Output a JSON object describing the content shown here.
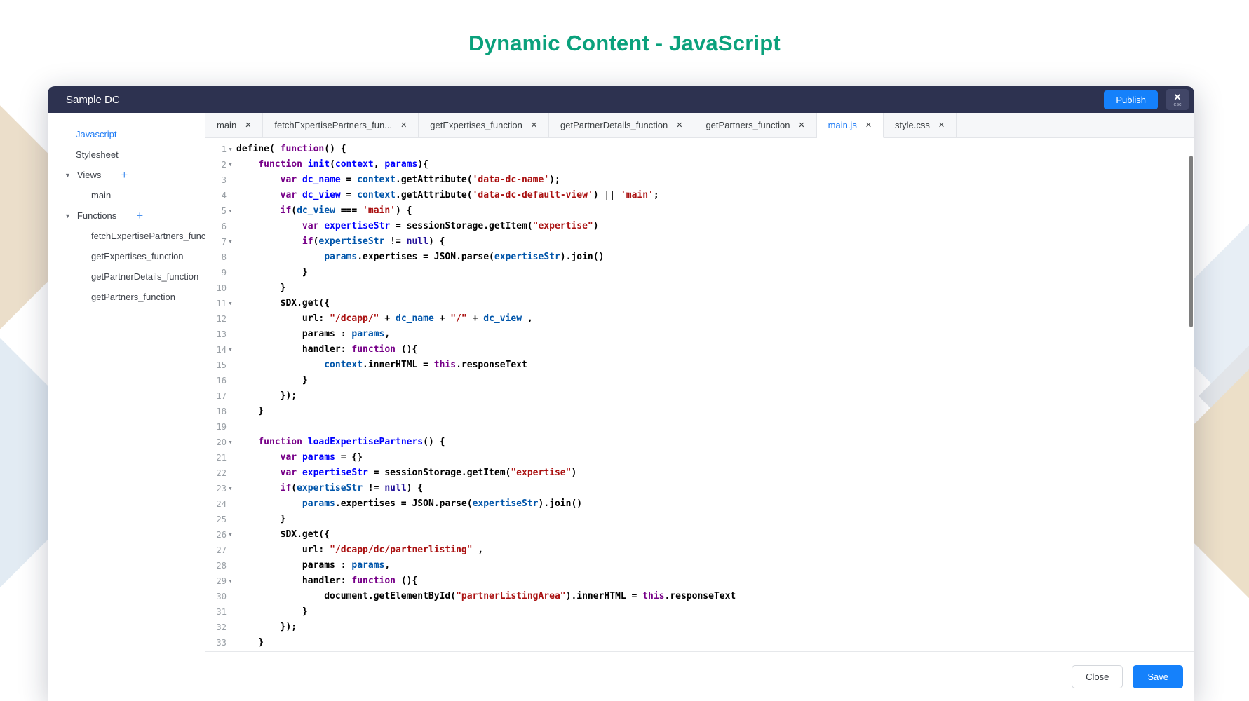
{
  "page": {
    "title": "Dynamic Content - JavaScript",
    "title_color": "#0ba17c"
  },
  "colors": {
    "header_bg": "#2d3250",
    "accent_blue": "#1581fb",
    "active_text": "#1f7cf5",
    "code_keyword": "#770088",
    "code_def": "#0000ff",
    "code_variable2": "#0055aa",
    "code_string": "#aa1111",
    "code_atom": "#221199"
  },
  "modal": {
    "header": {
      "title": "Sample DC",
      "publish_label": "Publish",
      "esc_label": "esc",
      "close_glyph": "✕"
    },
    "sidebar": {
      "items": [
        {
          "label": "Javascript",
          "type": "root",
          "active": true
        },
        {
          "label": "Stylesheet",
          "type": "root",
          "active": false
        },
        {
          "label": "Views",
          "type": "group",
          "has_add": true
        },
        {
          "label": "main",
          "type": "child"
        },
        {
          "label": "Functions",
          "type": "group",
          "has_add": true
        },
        {
          "label": "fetchExpertisePartners_func",
          "type": "child"
        },
        {
          "label": "getExpertises_function",
          "type": "child"
        },
        {
          "label": "getPartnerDetails_function",
          "type": "child"
        },
        {
          "label": "getPartners_function",
          "type": "child"
        }
      ],
      "arrow_glyph": "▼",
      "plus_glyph": "+"
    },
    "tabs": [
      {
        "label": "main",
        "active": false
      },
      {
        "label": "fetchExpertisePartners_fun...",
        "active": false
      },
      {
        "label": "getExpertises_function",
        "active": false
      },
      {
        "label": "getPartnerDetails_function",
        "active": false
      },
      {
        "label": "getPartners_function",
        "active": false
      },
      {
        "label": "main.js",
        "active": true
      },
      {
        "label": "style.css",
        "active": false
      }
    ],
    "tab_close_glyph": "✕",
    "editor": {
      "fold_glyph": "▼",
      "lines": [
        {
          "n": 1,
          "fold": true,
          "tokens": [
            [
              "p",
              "define( "
            ],
            [
              "kw",
              "function"
            ],
            [
              "p",
              "() {"
            ]
          ]
        },
        {
          "n": 2,
          "fold": true,
          "tokens": [
            [
              "p",
              "    "
            ],
            [
              "kw",
              "function"
            ],
            [
              "p",
              " "
            ],
            [
              "def",
              "init"
            ],
            [
              "p",
              "("
            ],
            [
              "def",
              "context"
            ],
            [
              "p",
              ", "
            ],
            [
              "def",
              "params"
            ],
            [
              "p",
              "){"
            ]
          ]
        },
        {
          "n": 3,
          "fold": false,
          "tokens": [
            [
              "p",
              "        "
            ],
            [
              "kw",
              "var"
            ],
            [
              "p",
              " "
            ],
            [
              "def",
              "dc_name"
            ],
            [
              "p",
              " = "
            ],
            [
              "v2",
              "context"
            ],
            [
              "p",
              ".getAttribute("
            ],
            [
              "str",
              "'data-dc-name'"
            ],
            [
              "p",
              ");"
            ]
          ]
        },
        {
          "n": 4,
          "fold": false,
          "tokens": [
            [
              "p",
              "        "
            ],
            [
              "kw",
              "var"
            ],
            [
              "p",
              " "
            ],
            [
              "def",
              "dc_view"
            ],
            [
              "p",
              " = "
            ],
            [
              "v2",
              "context"
            ],
            [
              "p",
              ".getAttribute("
            ],
            [
              "str",
              "'data-dc-default-view'"
            ],
            [
              "p",
              ") || "
            ],
            [
              "str",
              "'main'"
            ],
            [
              "p",
              ";"
            ]
          ]
        },
        {
          "n": 5,
          "fold": true,
          "tokens": [
            [
              "p",
              "        "
            ],
            [
              "kw",
              "if"
            ],
            [
              "p",
              "("
            ],
            [
              "v2",
              "dc_view"
            ],
            [
              "p",
              " === "
            ],
            [
              "str",
              "'main'"
            ],
            [
              "p",
              ") {"
            ]
          ]
        },
        {
          "n": 6,
          "fold": false,
          "tokens": [
            [
              "p",
              "            "
            ],
            [
              "kw",
              "var"
            ],
            [
              "p",
              " "
            ],
            [
              "def",
              "expertiseStr"
            ],
            [
              "p",
              " = sessionStorage.getItem("
            ],
            [
              "str",
              "\"expertise\""
            ],
            [
              "p",
              ")"
            ]
          ]
        },
        {
          "n": 7,
          "fold": true,
          "tokens": [
            [
              "p",
              "            "
            ],
            [
              "kw",
              "if"
            ],
            [
              "p",
              "("
            ],
            [
              "v2",
              "expertiseStr"
            ],
            [
              "p",
              " != "
            ],
            [
              "atom",
              "null"
            ],
            [
              "p",
              ") {"
            ]
          ]
        },
        {
          "n": 8,
          "fold": false,
          "tokens": [
            [
              "p",
              "                "
            ],
            [
              "v2",
              "params"
            ],
            [
              "p",
              ".expertises = JSON.parse("
            ],
            [
              "v2",
              "expertiseStr"
            ],
            [
              "p",
              ").join()"
            ]
          ]
        },
        {
          "n": 9,
          "fold": false,
          "tokens": [
            [
              "p",
              "            }"
            ]
          ]
        },
        {
          "n": 10,
          "fold": false,
          "tokens": [
            [
              "p",
              "        }"
            ]
          ]
        },
        {
          "n": 11,
          "fold": true,
          "tokens": [
            [
              "p",
              "        $DX.get({"
            ]
          ]
        },
        {
          "n": 12,
          "fold": false,
          "tokens": [
            [
              "p",
              "            url: "
            ],
            [
              "str",
              "\"/dcapp/\""
            ],
            [
              "p",
              " + "
            ],
            [
              "v2",
              "dc_name"
            ],
            [
              "p",
              " + "
            ],
            [
              "str",
              "\"/\""
            ],
            [
              "p",
              " + "
            ],
            [
              "v2",
              "dc_view"
            ],
            [
              "p",
              " ,"
            ]
          ]
        },
        {
          "n": 13,
          "fold": false,
          "tokens": [
            [
              "p",
              "            params : "
            ],
            [
              "v2",
              "params"
            ],
            [
              "p",
              ","
            ]
          ]
        },
        {
          "n": 14,
          "fold": true,
          "tokens": [
            [
              "p",
              "            handler: "
            ],
            [
              "kw",
              "function"
            ],
            [
              "p",
              " (){"
            ]
          ]
        },
        {
          "n": 15,
          "fold": false,
          "tokens": [
            [
              "p",
              "                "
            ],
            [
              "v2",
              "context"
            ],
            [
              "p",
              ".innerHTML = "
            ],
            [
              "kw",
              "this"
            ],
            [
              "p",
              ".responseText"
            ]
          ]
        },
        {
          "n": 16,
          "fold": false,
          "tokens": [
            [
              "p",
              "            }"
            ]
          ]
        },
        {
          "n": 17,
          "fold": false,
          "tokens": [
            [
              "p",
              "        });"
            ]
          ]
        },
        {
          "n": 18,
          "fold": false,
          "tokens": [
            [
              "p",
              "    }"
            ]
          ]
        },
        {
          "n": 19,
          "fold": false,
          "tokens": [
            [
              "p",
              ""
            ]
          ]
        },
        {
          "n": 20,
          "fold": true,
          "tokens": [
            [
              "p",
              "    "
            ],
            [
              "kw",
              "function"
            ],
            [
              "p",
              " "
            ],
            [
              "def",
              "loadExpertisePartners"
            ],
            [
              "p",
              "() {"
            ]
          ]
        },
        {
          "n": 21,
          "fold": false,
          "tokens": [
            [
              "p",
              "        "
            ],
            [
              "kw",
              "var"
            ],
            [
              "p",
              " "
            ],
            [
              "def",
              "params"
            ],
            [
              "p",
              " = {}"
            ]
          ]
        },
        {
          "n": 22,
          "fold": false,
          "tokens": [
            [
              "p",
              "        "
            ],
            [
              "kw",
              "var"
            ],
            [
              "p",
              " "
            ],
            [
              "def",
              "expertiseStr"
            ],
            [
              "p",
              " = sessionStorage.getItem("
            ],
            [
              "str",
              "\"expertise\""
            ],
            [
              "p",
              ")"
            ]
          ]
        },
        {
          "n": 23,
          "fold": true,
          "tokens": [
            [
              "p",
              "        "
            ],
            [
              "kw",
              "if"
            ],
            [
              "p",
              "("
            ],
            [
              "v2",
              "expertiseStr"
            ],
            [
              "p",
              " != "
            ],
            [
              "atom",
              "null"
            ],
            [
              "p",
              ") {"
            ]
          ]
        },
        {
          "n": 24,
          "fold": false,
          "tokens": [
            [
              "p",
              "            "
            ],
            [
              "v2",
              "params"
            ],
            [
              "p",
              ".expertises = JSON.parse("
            ],
            [
              "v2",
              "expertiseStr"
            ],
            [
              "p",
              ").join()"
            ]
          ]
        },
        {
          "n": 25,
          "fold": false,
          "tokens": [
            [
              "p",
              "        }"
            ]
          ]
        },
        {
          "n": 26,
          "fold": true,
          "tokens": [
            [
              "p",
              "        $DX.get({"
            ]
          ]
        },
        {
          "n": 27,
          "fold": false,
          "tokens": [
            [
              "p",
              "            url: "
            ],
            [
              "str",
              "\"/dcapp/dc/partnerlisting\""
            ],
            [
              "p",
              " ,"
            ]
          ]
        },
        {
          "n": 28,
          "fold": false,
          "tokens": [
            [
              "p",
              "            params : "
            ],
            [
              "v2",
              "params"
            ],
            [
              "p",
              ","
            ]
          ]
        },
        {
          "n": 29,
          "fold": true,
          "tokens": [
            [
              "p",
              "            handler: "
            ],
            [
              "kw",
              "function"
            ],
            [
              "p",
              " (){"
            ]
          ]
        },
        {
          "n": 30,
          "fold": false,
          "tokens": [
            [
              "p",
              "                document.getElementById("
            ],
            [
              "str",
              "\"partnerListingArea\""
            ],
            [
              "p",
              ").innerHTML = "
            ],
            [
              "kw",
              "this"
            ],
            [
              "p",
              ".responseText"
            ]
          ]
        },
        {
          "n": 31,
          "fold": false,
          "tokens": [
            [
              "p",
              "            }"
            ]
          ]
        },
        {
          "n": 32,
          "fold": false,
          "tokens": [
            [
              "p",
              "        });"
            ]
          ]
        },
        {
          "n": 33,
          "fold": false,
          "tokens": [
            [
              "p",
              "    }"
            ]
          ]
        }
      ]
    },
    "footer": {
      "close_label": "Close",
      "save_label": "Save"
    }
  }
}
